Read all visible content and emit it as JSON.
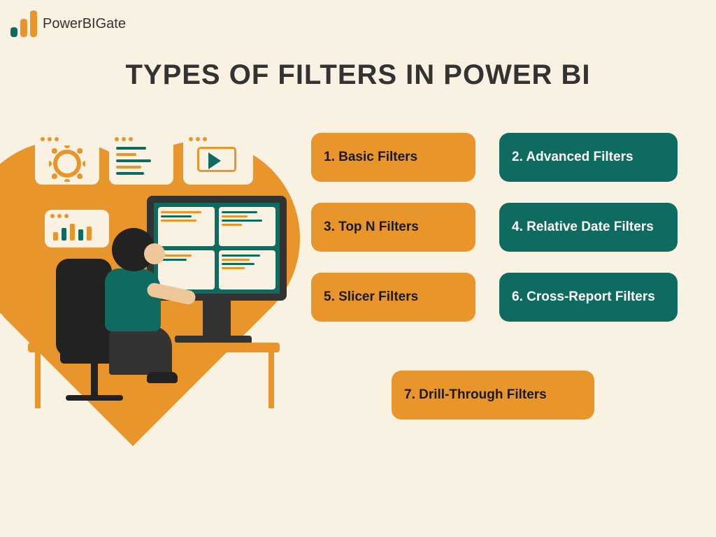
{
  "brand": {
    "name": "PowerBIGate"
  },
  "title": "TYPES OF FILTERS IN POWER BI",
  "filters": {
    "f1": "1. Basic Filters",
    "f2": "2. Advanced Filters",
    "f3": "3. Top N Filters",
    "f4": "4. Relative Date Filters",
    "f5": "5. Slicer Filters",
    "f6": "6. Cross-Report Filters",
    "f7": "7. Drill-Through Filters"
  },
  "colors": {
    "background": "#f9f1e1",
    "orange": "#e8962b",
    "teal": "#0f6b60",
    "text_dark": "#333333",
    "text_light": "#ffffff"
  },
  "icons": {
    "logo": "bar-chart-icon",
    "card1": "gear-icon",
    "card2": "code-lines-icon",
    "card3": "play-icon",
    "card4": "bar-chart-icon"
  }
}
